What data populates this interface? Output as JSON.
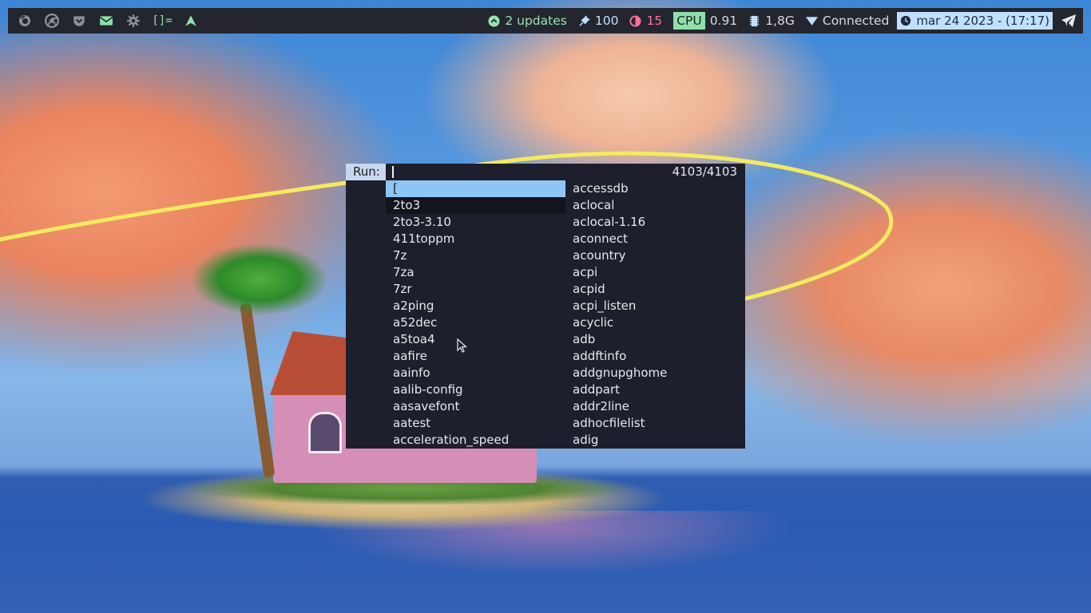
{
  "topbar": {
    "left_icons": [
      "firefox-icon",
      "chrome-icon",
      "pocket-icon",
      "mail-icon",
      "settings-icon",
      "layout-icon",
      "arch-icon"
    ],
    "layout_symbol": "[]=",
    "updates": "2 updates",
    "battery": "100",
    "brightness": "15",
    "cpu_label": "CPU",
    "cpu_value": "0.91",
    "memory": "1,8G",
    "network": "Connected",
    "clock": "mar 24 2023 - (17:17)",
    "colors": {
      "bar_bg": "#24262f",
      "accent_green": "#8fe0a8",
      "accent_pink": "#ff6f9c",
      "accent_blue": "#bfe0ff"
    }
  },
  "launcher": {
    "prompt": "Run:",
    "input_value": "",
    "count": "4103/4103",
    "selected_color": "#8fc5f4",
    "left_column": [
      "[",
      "2to3",
      "2to3-3.10",
      "411toppm",
      "7z",
      "7za",
      "7zr",
      "a2ping",
      "a52dec",
      "a5toa4",
      "aafire",
      "aainfo",
      "aalib-config",
      "aasavefont",
      "aatest",
      "acceleration_speed"
    ],
    "right_column": [
      "accessdb",
      "aclocal",
      "aclocal-1.16",
      "aconnect",
      "acountry",
      "acpi",
      "acpid",
      "acpi_listen",
      "acyclic",
      "adb",
      "addftinfo",
      "addgnupghome",
      "addpart",
      "addr2line",
      "adhocfilelist",
      "adig"
    ]
  }
}
